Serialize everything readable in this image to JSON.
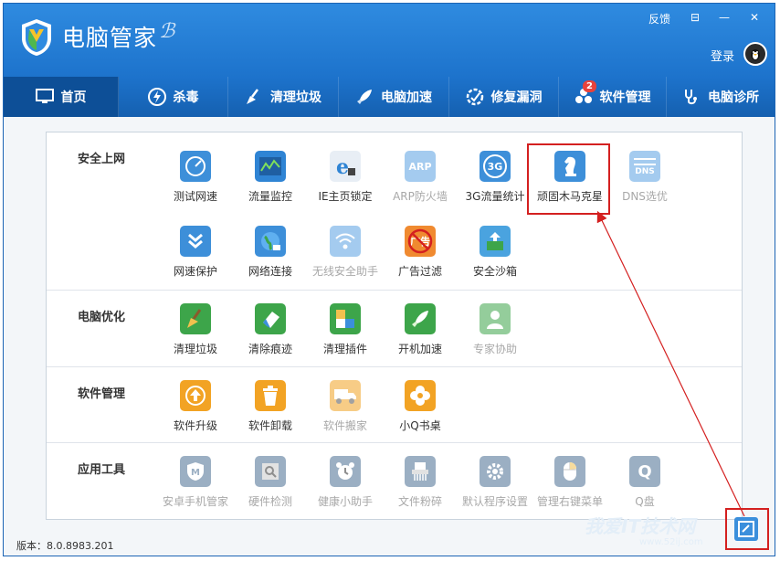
{
  "window": {
    "title": "电脑管家",
    "controls": {
      "feedback": "反馈",
      "menu": "⊟",
      "minimize": "—",
      "close": "✕"
    },
    "login": "登录"
  },
  "nav": {
    "tabs": [
      {
        "label": "首页",
        "icon": "monitor-icon",
        "active": true
      },
      {
        "label": "杀毒",
        "icon": "lightning-shield-icon"
      },
      {
        "label": "清理垃圾",
        "icon": "broom-icon"
      },
      {
        "label": "电脑加速",
        "icon": "rocket-icon"
      },
      {
        "label": "修复漏洞",
        "icon": "repair-icon"
      },
      {
        "label": "软件管理",
        "icon": "software-icon",
        "badge": "2"
      },
      {
        "label": "电脑诊所",
        "icon": "stethoscope-icon"
      }
    ]
  },
  "sections": [
    {
      "title": "安全上网",
      "items": [
        {
          "label": "测试网速",
          "icon": "speedometer-icon",
          "color": "#3d8fd9"
        },
        {
          "label": "流量监控",
          "icon": "chart-icon",
          "color": "#2f84d4"
        },
        {
          "label": "IE主页锁定",
          "icon": "ie-lock-icon",
          "color": "#ffffff"
        },
        {
          "label": "ARP防火墙",
          "icon": "arp-icon",
          "color": "#5aa1e3",
          "disabled": true,
          "text": "ARP"
        },
        {
          "label": "3G流量统计",
          "icon": "3g-icon",
          "color": "#3d8fd9",
          "text": "3G"
        },
        {
          "label": "顽固木马克星",
          "icon": "chess-knight-icon",
          "color": "#3d8fd9"
        },
        {
          "label": "DNS选优",
          "icon": "dns-icon",
          "color": "#5aa1e3",
          "disabled": true,
          "text": "DNS"
        },
        {
          "label": "网速保护",
          "icon": "double-chevron-icon",
          "color": "#3d8fd9"
        },
        {
          "label": "网络连接",
          "icon": "globe-icon",
          "color": "#3d8fd9"
        },
        {
          "label": "无线安全助手",
          "icon": "wifi-icon",
          "color": "#5aa1e3",
          "disabled": true
        },
        {
          "label": "广告过滤",
          "icon": "ad-block-icon",
          "color": "#f08a30",
          "text": "广告"
        },
        {
          "label": "安全沙箱",
          "icon": "sandbox-icon",
          "color": "#4aa3df"
        }
      ]
    },
    {
      "title": "电脑优化",
      "items": [
        {
          "label": "清理垃圾",
          "icon": "broom-icon",
          "color": "#3da54a"
        },
        {
          "label": "清除痕迹",
          "icon": "eraser-icon",
          "color": "#3da54a"
        },
        {
          "label": "清理插件",
          "icon": "puzzle-icon",
          "color": "#3da54a"
        },
        {
          "label": "开机加速",
          "icon": "rocket-icon",
          "color": "#3da54a"
        },
        {
          "label": "专家协助",
          "icon": "expert-icon",
          "color": "#3da54a",
          "disabled": true
        }
      ]
    },
    {
      "title": "软件管理",
      "items": [
        {
          "label": "软件升级",
          "icon": "upgrade-icon",
          "color": "#f2a324"
        },
        {
          "label": "软件卸载",
          "icon": "trash-icon",
          "color": "#f2a324"
        },
        {
          "label": "软件搬家",
          "icon": "truck-icon",
          "color": "#f2a324",
          "disabled": true
        },
        {
          "label": "小Q书桌",
          "icon": "clover-icon",
          "color": "#f2a324"
        }
      ]
    },
    {
      "title": "应用工具",
      "items": [
        {
          "label": "安卓手机管家",
          "icon": "android-shield-icon",
          "color": "#4a6e93",
          "disabled": true
        },
        {
          "label": "硬件检测",
          "icon": "hardware-icon",
          "color": "#4a6e93",
          "disabled": true
        },
        {
          "label": "健康小助手",
          "icon": "alarm-clock-icon",
          "color": "#4a6e93",
          "disabled": true
        },
        {
          "label": "文件粉碎",
          "icon": "shredder-icon",
          "color": "#4a6e93",
          "disabled": true
        },
        {
          "label": "默认程序设置",
          "icon": "gear-icon",
          "color": "#4a6e93",
          "disabled": true
        },
        {
          "label": "管理右键菜单",
          "icon": "mouse-icon",
          "color": "#4a6e93",
          "disabled": true
        },
        {
          "label": "Q盘",
          "icon": "q-disk-icon",
          "color": "#4a6e93",
          "disabled": true,
          "text": "Q"
        }
      ]
    }
  ],
  "footer": {
    "version": "版本：8.0.8983.201"
  },
  "watermark": {
    "line1": "我爱IT技术网",
    "line2": "www.52ij.com"
  }
}
